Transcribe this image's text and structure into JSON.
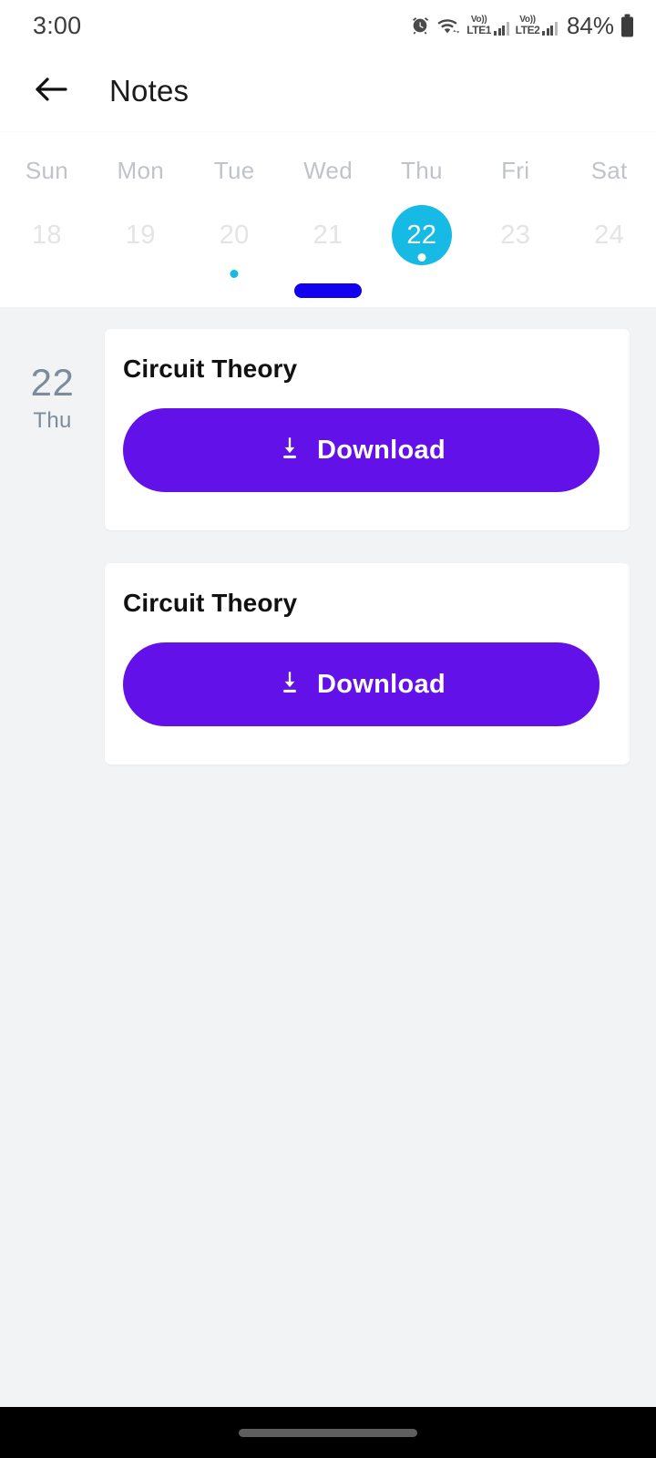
{
  "status_bar": {
    "time": "3:00",
    "battery_percent": "84%",
    "icons": [
      "alarm-icon",
      "wifi-icon",
      "signal-sim1-icon",
      "signal-sim2-icon",
      "battery-icon"
    ],
    "sim1_volte": "Vo))",
    "sim1_label": "LTE1",
    "sim2_volte": "Vo))",
    "sim2_label": "LTE2"
  },
  "app_bar": {
    "back_icon": "arrow-left-icon",
    "title": "Notes"
  },
  "calendar": {
    "weekday_headers": [
      "Sun",
      "Mon",
      "Tue",
      "Wed",
      "Thu",
      "Fri",
      "Sat"
    ],
    "dates": [
      {
        "day": "18",
        "selected": false,
        "has_event": false
      },
      {
        "day": "19",
        "selected": false,
        "has_event": false
      },
      {
        "day": "20",
        "selected": false,
        "has_event": true
      },
      {
        "day": "21",
        "selected": false,
        "has_event": false
      },
      {
        "day": "22",
        "selected": true,
        "has_event": true
      },
      {
        "day": "23",
        "selected": false,
        "has_event": false
      },
      {
        "day": "24",
        "selected": false,
        "has_event": false
      }
    ],
    "selected_color": "#16bae4",
    "event_dot_color": "#16bae4",
    "drag_handle_color": "#1200ee"
  },
  "content": {
    "day_group": {
      "day_number": "22",
      "day_name": "Thu"
    },
    "notes": [
      {
        "title": "Circuit Theory",
        "download_label": "Download",
        "download_icon": "download-icon"
      },
      {
        "title": "Circuit Theory",
        "download_label": "Download",
        "download_icon": "download-icon"
      }
    ],
    "accent_color": "#6211e8",
    "background_color": "#f2f3f5"
  },
  "nav_bar": {
    "gesture_pill": "home-gesture-pill"
  }
}
